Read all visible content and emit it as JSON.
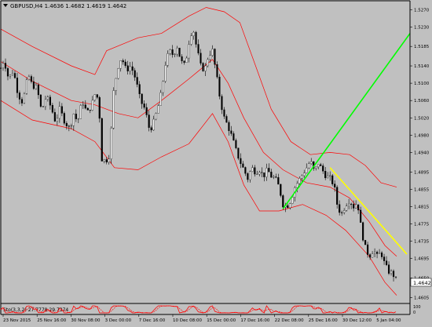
{
  "header": {
    "title": "GBPUSD,H4 1.4636 1.4682 1.4619 1.4642"
  },
  "price_axis": {
    "ticks": [
      "1.5270",
      "1.5230",
      "1.5185",
      "1.5140",
      "1.5100",
      "1.5060",
      "1.5020",
      "1.4980",
      "1.4940",
      "1.4895",
      "1.4855",
      "1.4815",
      "1.4775",
      "1.4735",
      "1.4695",
      "1.4650",
      "1.4605"
    ],
    "current_price": "1.4642"
  },
  "time_axis": {
    "ticks": [
      "23 Nov 2015",
      "25 Nov 16:00",
      "30 Nov 08:00",
      "3 Dec 00:00",
      "7 Dec 16:00",
      "10 Dec 08:00",
      "15 Dec 00:00",
      "17 Dec 16:00",
      "22 Dec 08:00",
      "25 Dec 16:00",
      "30 Dec 12:00",
      "5 Jan 04:00"
    ]
  },
  "indicator": {
    "label": "Sto(3,3,2) 27.7778 29.7374",
    "scale_top": "100",
    "scale_bottom": "0"
  },
  "colors": {
    "background": "#c0c0c0",
    "candle_up": "#ffffff",
    "candle_down": "#000000",
    "band": "#ff0000",
    "green_line": "#00ff00",
    "yellow_line": "#ffff00"
  },
  "chart_data": {
    "type": "candlestick",
    "symbol": "GBPUSD",
    "timeframe": "H4",
    "y_range": [
      1.4593,
      1.5285
    ],
    "close_path": [
      {
        "t": 0,
        "p": 1.5135
      },
      {
        "t": 4,
        "p": 1.5155
      },
      {
        "t": 10,
        "p": 1.511
      },
      {
        "t": 16,
        "p": 1.513
      },
      {
        "t": 22,
        "p": 1.5075
      },
      {
        "t": 28,
        "p": 1.5055
      },
      {
        "t": 35,
        "p": 1.512
      },
      {
        "t": 40,
        "p": 1.5095
      },
      {
        "t": 46,
        "p": 1.509
      },
      {
        "t": 52,
        "p": 1.5035
      },
      {
        "t": 58,
        "p": 1.507
      },
      {
        "t": 64,
        "p": 1.5045
      },
      {
        "t": 70,
        "p": 1.501
      },
      {
        "t": 75,
        "p": 1.504
      },
      {
        "t": 82,
        "p": 1.501
      },
      {
        "t": 88,
        "p": 1.4995
      },
      {
        "t": 93,
        "p": 1.503
      },
      {
        "t": 98,
        "p": 1.501
      },
      {
        "t": 104,
        "p": 1.506
      },
      {
        "t": 110,
        "p": 1.503
      },
      {
        "t": 116,
        "p": 1.505
      },
      {
        "t": 121,
        "p": 1.508
      },
      {
        "t": 125,
        "p": 1.5055
      },
      {
        "t": 129,
        "p": 1.4925
      },
      {
        "t": 134,
        "p": 1.492
      },
      {
        "t": 139,
        "p": 1.4935
      },
      {
        "t": 144,
        "p": 1.508
      },
      {
        "t": 149,
        "p": 1.5135
      },
      {
        "t": 154,
        "p": 1.516
      },
      {
        "t": 160,
        "p": 1.513
      },
      {
        "t": 166,
        "p": 1.514
      },
      {
        "t": 172,
        "p": 1.511
      },
      {
        "t": 178,
        "p": 1.506
      },
      {
        "t": 184,
        "p": 1.504
      },
      {
        "t": 190,
        "p": 1.499
      },
      {
        "t": 195,
        "p": 1.501
      },
      {
        "t": 200,
        "p": 1.504
      },
      {
        "t": 205,
        "p": 1.508
      },
      {
        "t": 210,
        "p": 1.5145
      },
      {
        "t": 215,
        "p": 1.5175
      },
      {
        "t": 220,
        "p": 1.5165
      },
      {
        "t": 225,
        "p": 1.5185
      },
      {
        "t": 230,
        "p": 1.515
      },
      {
        "t": 235,
        "p": 1.514
      },
      {
        "t": 240,
        "p": 1.5195
      },
      {
        "t": 245,
        "p": 1.523
      },
      {
        "t": 250,
        "p": 1.518
      },
      {
        "t": 255,
        "p": 1.514
      },
      {
        "t": 260,
        "p": 1.513
      },
      {
        "t": 265,
        "p": 1.5165
      },
      {
        "t": 270,
        "p": 1.5175
      },
      {
        "t": 275,
        "p": 1.512
      },
      {
        "t": 280,
        "p": 1.506
      },
      {
        "t": 285,
        "p": 1.502
      },
      {
        "t": 290,
        "p": 1.5
      },
      {
        "t": 295,
        "p": 1.4975
      },
      {
        "t": 300,
        "p": 1.4945
      },
      {
        "t": 305,
        "p": 1.492
      },
      {
        "t": 310,
        "p": 1.49
      },
      {
        "t": 315,
        "p": 1.488
      },
      {
        "t": 320,
        "p": 1.4905
      },
      {
        "t": 325,
        "p": 1.4895
      },
      {
        "t": 330,
        "p": 1.49
      },
      {
        "t": 335,
        "p": 1.4885
      },
      {
        "t": 340,
        "p": 1.49
      },
      {
        "t": 345,
        "p": 1.4885
      },
      {
        "t": 350,
        "p": 1.488
      },
      {
        "t": 355,
        "p": 1.486
      },
      {
        "t": 360,
        "p": 1.482
      },
      {
        "t": 365,
        "p": 1.4815
      },
      {
        "t": 370,
        "p": 1.483
      },
      {
        "t": 375,
        "p": 1.486
      },
      {
        "t": 380,
        "p": 1.4875
      },
      {
        "t": 385,
        "p": 1.489
      },
      {
        "t": 390,
        "p": 1.4905
      },
      {
        "t": 395,
        "p": 1.492
      },
      {
        "t": 400,
        "p": 1.4895
      },
      {
        "t": 405,
        "p": 1.4915
      },
      {
        "t": 410,
        "p": 1.49
      },
      {
        "t": 415,
        "p": 1.4885
      },
      {
        "t": 420,
        "p": 1.488
      },
      {
        "t": 425,
        "p": 1.4865
      },
      {
        "t": 430,
        "p": 1.481
      },
      {
        "t": 435,
        "p": 1.48
      },
      {
        "t": 440,
        "p": 1.482
      },
      {
        "t": 445,
        "p": 1.483
      },
      {
        "t": 450,
        "p": 1.4815
      },
      {
        "t": 455,
        "p": 1.4825
      },
      {
        "t": 460,
        "p": 1.476
      },
      {
        "t": 465,
        "p": 1.472
      },
      {
        "t": 470,
        "p": 1.47
      },
      {
        "t": 475,
        "p": 1.4715
      },
      {
        "t": 480,
        "p": 1.47
      },
      {
        "t": 485,
        "p": 1.471
      },
      {
        "t": 490,
        "p": 1.468
      },
      {
        "t": 495,
        "p": 1.4665
      },
      {
        "t": 500,
        "p": 1.466
      },
      {
        "t": 505,
        "p": 1.4642
      }
    ],
    "bands": {
      "upper": [
        {
          "t": 0,
          "p": 1.5225
        },
        {
          "t": 40,
          "p": 1.5185
        },
        {
          "t": 90,
          "p": 1.514
        },
        {
          "t": 120,
          "p": 1.512
        },
        {
          "t": 135,
          "p": 1.5175
        },
        {
          "t": 155,
          "p": 1.519
        },
        {
          "t": 175,
          "p": 1.5205
        },
        {
          "t": 205,
          "p": 1.5215
        },
        {
          "t": 240,
          "p": 1.5255
        },
        {
          "t": 262,
          "p": 1.5275
        },
        {
          "t": 285,
          "p": 1.5265
        },
        {
          "t": 305,
          "p": 1.524
        },
        {
          "t": 325,
          "p": 1.514
        },
        {
          "t": 345,
          "p": 1.504
        },
        {
          "t": 370,
          "p": 1.4965
        },
        {
          "t": 395,
          "p": 1.4935
        },
        {
          "t": 420,
          "p": 1.494
        },
        {
          "t": 445,
          "p": 1.4935
        },
        {
          "t": 465,
          "p": 1.491
        },
        {
          "t": 485,
          "p": 1.487
        },
        {
          "t": 505,
          "p": 1.486
        }
      ],
      "middle": [
        {
          "t": 0,
          "p": 1.515
        },
        {
          "t": 40,
          "p": 1.5105
        },
        {
          "t": 90,
          "p": 1.506
        },
        {
          "t": 120,
          "p": 1.505
        },
        {
          "t": 150,
          "p": 1.503
        },
        {
          "t": 175,
          "p": 1.502
        },
        {
          "t": 205,
          "p": 1.506
        },
        {
          "t": 240,
          "p": 1.511
        },
        {
          "t": 270,
          "p": 1.5155
        },
        {
          "t": 290,
          "p": 1.51
        },
        {
          "t": 310,
          "p": 1.502
        },
        {
          "t": 335,
          "p": 1.494
        },
        {
          "t": 360,
          "p": 1.49
        },
        {
          "t": 390,
          "p": 1.487
        },
        {
          "t": 420,
          "p": 1.486
        },
        {
          "t": 445,
          "p": 1.4835
        },
        {
          "t": 470,
          "p": 1.478
        },
        {
          "t": 490,
          "p": 1.4725
        },
        {
          "t": 505,
          "p": 1.47
        }
      ],
      "lower": [
        {
          "t": 0,
          "p": 1.506
        },
        {
          "t": 40,
          "p": 1.5015
        },
        {
          "t": 90,
          "p": 1.4995
        },
        {
          "t": 120,
          "p": 1.4965
        },
        {
          "t": 145,
          "p": 1.4905
        },
        {
          "t": 175,
          "p": 1.49
        },
        {
          "t": 205,
          "p": 1.493
        },
        {
          "t": 240,
          "p": 1.496
        },
        {
          "t": 270,
          "p": 1.503
        },
        {
          "t": 290,
          "p": 1.4965
        },
        {
          "t": 310,
          "p": 1.4865
        },
        {
          "t": 330,
          "p": 1.4805
        },
        {
          "t": 355,
          "p": 1.4805
        },
        {
          "t": 385,
          "p": 1.482
        },
        {
          "t": 415,
          "p": 1.4795
        },
        {
          "t": 440,
          "p": 1.476
        },
        {
          "t": 470,
          "p": 1.47
        },
        {
          "t": 490,
          "p": 1.464
        },
        {
          "t": 505,
          "p": 1.461
        }
      ]
    },
    "trendlines": [
      {
        "color": "green",
        "from": {
          "t": 360,
          "p": 1.481
        },
        "to": {
          "t": 522,
          "p": 1.5215
        }
      },
      {
        "color": "yellow",
        "from": {
          "t": 420,
          "p": 1.4905
        },
        "to": {
          "t": 518,
          "p": 1.4705
        }
      }
    ]
  }
}
